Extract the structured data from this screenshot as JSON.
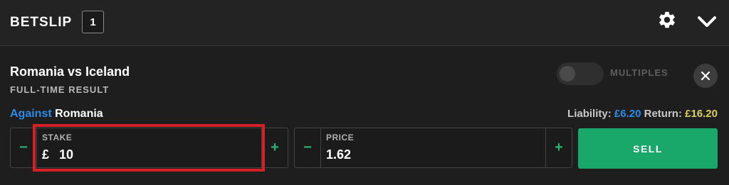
{
  "header": {
    "title": "BETSLIP",
    "count": "1",
    "settings_icon": "gear-icon",
    "collapse_icon": "chevron-down-icon"
  },
  "bet": {
    "event": "Romania vs Iceland",
    "market": "FULL-TIME RESULT",
    "multiples_label": "MULTIPLES",
    "multiples_enabled": false,
    "close_icon": "close-icon",
    "side": "Against",
    "selection": "Romania",
    "liability_label": "Liability:",
    "liability_value": "£6.20",
    "return_label": "Return:",
    "return_value": "£16.20"
  },
  "stake": {
    "label": "STAKE",
    "currency": "£",
    "value": "10",
    "minus": "−",
    "plus": "+"
  },
  "price": {
    "label": "PRICE",
    "value": "1.62",
    "minus": "−",
    "plus": "+"
  },
  "action": {
    "sell_label": "SELL"
  },
  "colors": {
    "accent_green": "#1aa86a",
    "against_blue": "#2e8be8",
    "return_yellow": "#d8d060",
    "highlight_red": "#d61f26"
  }
}
